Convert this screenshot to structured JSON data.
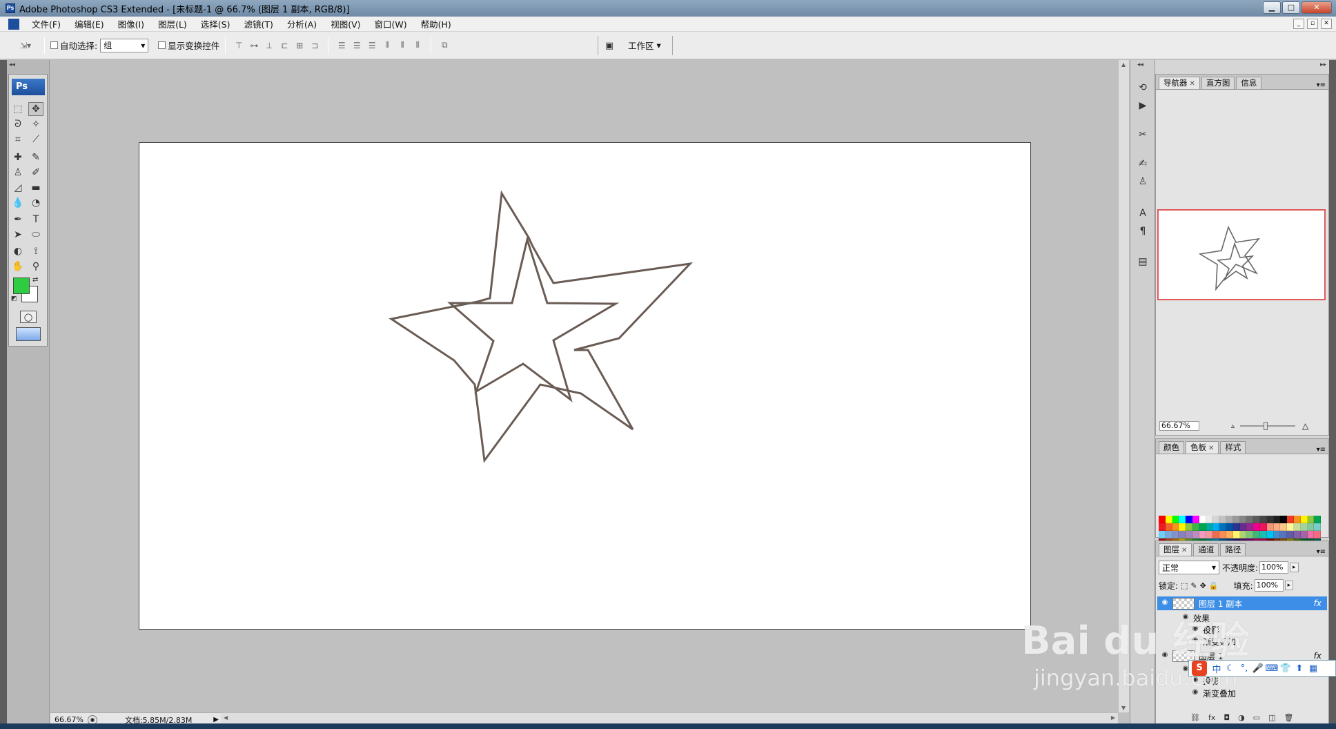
{
  "window": {
    "title": "Adobe Photoshop CS3 Extended - [未标题-1 @ 66.7% (图层 1 副本, RGB/8)]"
  },
  "menu": [
    "文件(F)",
    "编辑(E)",
    "图像(I)",
    "图层(L)",
    "选择(S)",
    "滤镜(T)",
    "分析(A)",
    "视图(V)",
    "窗口(W)",
    "帮助(H)"
  ],
  "options": {
    "auto_select_label": "自动选择:",
    "auto_select_value": "组",
    "show_transform_label": "显示变换控件",
    "workspace_label": "工作区"
  },
  "toolbox": {
    "logo": "Ps"
  },
  "status": {
    "zoom": "66.67%",
    "doc": "文档:5.85M/2.83M"
  },
  "navigator": {
    "tabs": [
      "导航器",
      "直方图",
      "信息"
    ],
    "zoom": "66.67%"
  },
  "color_panel": {
    "tabs": [
      "颜色",
      "色板",
      "样式"
    ]
  },
  "layers": {
    "tabs": [
      "图层",
      "通道",
      "路径"
    ],
    "blend_mode": "正常",
    "opacity_label": "不透明度:",
    "opacity_value": "100%",
    "lock_label": "锁定:",
    "fill_label": "填充:",
    "fill_value": "100%",
    "rows": [
      {
        "name": "图层 1 副本",
        "fx": "fx"
      },
      {
        "name": "效果"
      },
      {
        "name": "投影"
      },
      {
        "name": "渐变叠加"
      },
      {
        "name": "图层 1",
        "fx": "fx"
      },
      {
        "name": "效果"
      },
      {
        "name": "投影"
      },
      {
        "name": "渐变叠加"
      }
    ]
  },
  "watermark": {
    "brand": "Bai du 经验",
    "url": "jingyan.baidu.com"
  },
  "ime": {
    "logo": "S",
    "mode": "中"
  },
  "colors": {
    "foreground": "#2ecc40",
    "background": "#ffffff",
    "layer_selected": "#3d8ee6",
    "nav_frame": "#e05a5a"
  }
}
